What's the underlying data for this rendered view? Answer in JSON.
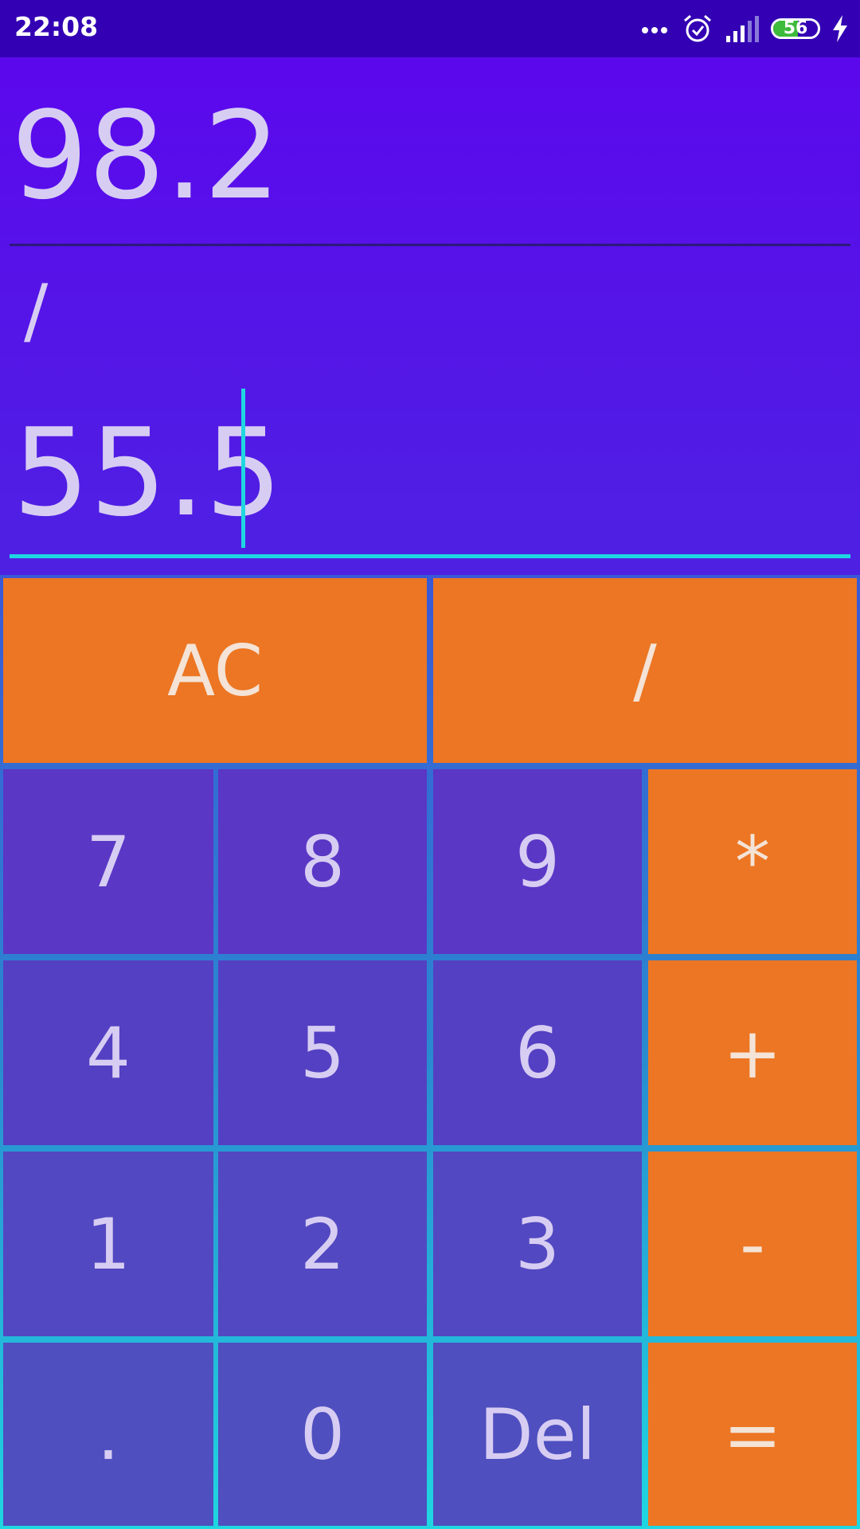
{
  "status_bar": {
    "time": "22:08",
    "battery_level": "56",
    "battery_fraction": 0.56,
    "icons": [
      "more-dots-icon",
      "alarm-icon",
      "signal-icon",
      "battery-icon",
      "charging-icon"
    ]
  },
  "display": {
    "result": "98.2",
    "operator": "/",
    "input_value": "55.5"
  },
  "keys": {
    "ac": "AC",
    "divide": "/",
    "seven": "7",
    "eight": "8",
    "nine": "9",
    "multiply": "*",
    "four": "4",
    "five": "5",
    "six": "6",
    "plus": "+",
    "one": "1",
    "two": "2",
    "three": "3",
    "minus": "-",
    "dot": ".",
    "zero": "0",
    "del": "Del",
    "equals": "="
  },
  "colors": {
    "status_bar": "#3300b4",
    "background_top": "#5d05ee",
    "background_bottom": "#3a4ad8",
    "operator_key": "#ec7623",
    "number_key": "#5a37c5",
    "accent": "#1fd7e0",
    "text": "#d7cdf3"
  }
}
